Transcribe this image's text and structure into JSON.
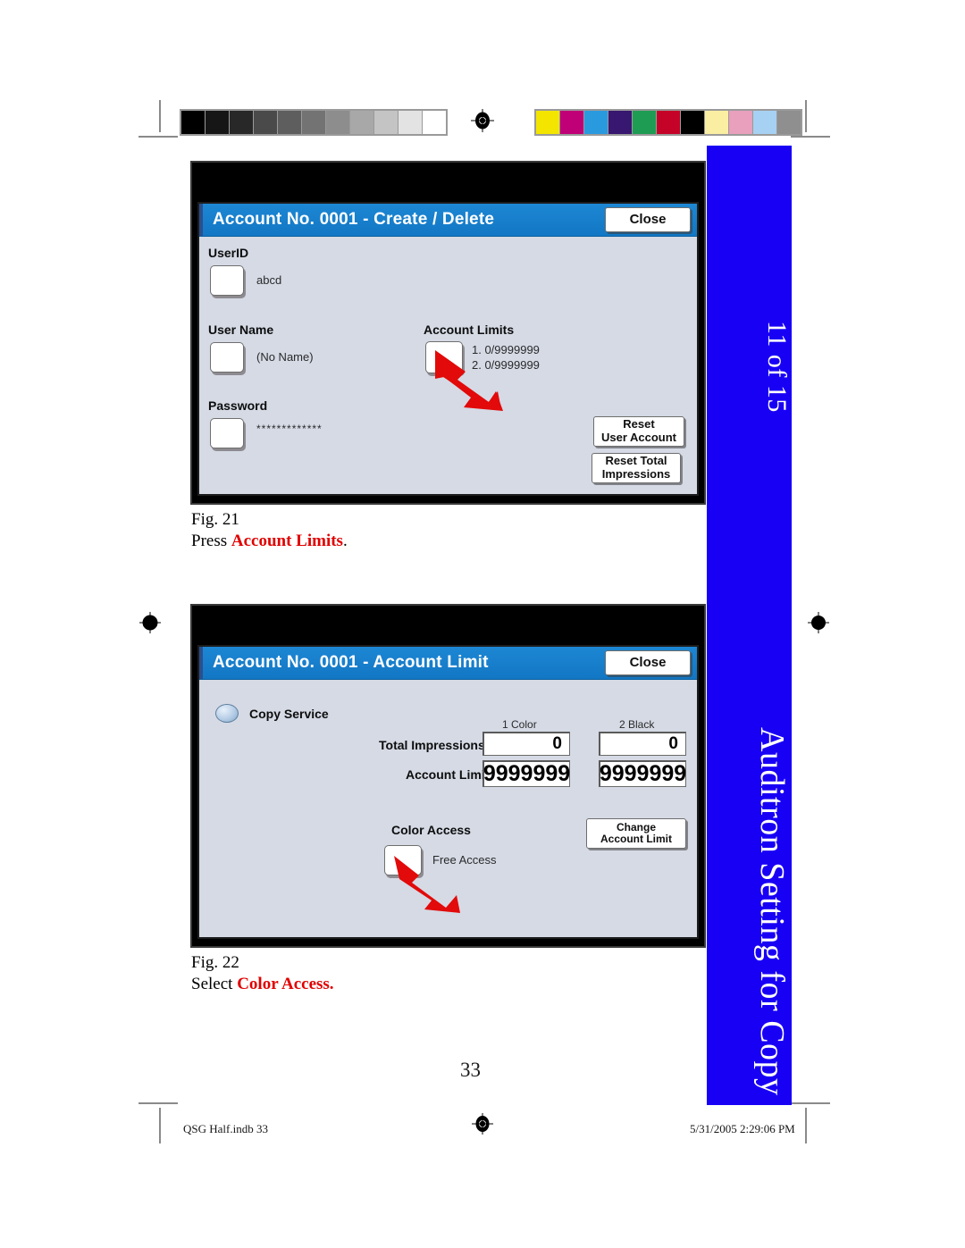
{
  "document": {
    "page_number": "33",
    "footer_left": "QSG Half.indb   33",
    "footer_right": "5/31/2005   2:29:06 PM"
  },
  "side_tab": {
    "top_label": "11 of 15",
    "bottom_label": "Auditron Setting for Copy",
    "color": "#1800f5"
  },
  "figures": [
    {
      "id": "fig21",
      "caption_line1": "Fig. 21",
      "caption_prefix": "Press ",
      "caption_emphasis": "Account Limits",
      "caption_suffix": "."
    },
    {
      "id": "fig22",
      "caption_line1": "Fig. 22",
      "caption_prefix": "Select ",
      "caption_emphasis": "Color Access.",
      "caption_suffix": ""
    }
  ],
  "screen1": {
    "title": "Account No. 0001 - Create / Delete",
    "close_label": "Close",
    "userid_label": "UserID",
    "userid_value": "abcd",
    "username_label": "User Name",
    "username_value": "(No Name)",
    "password_label": "Password",
    "password_value": "*************",
    "account_limits_label": "Account Limits",
    "account_limit_1": "1. 0/9999999",
    "account_limit_2": "2. 0/9999999",
    "reset_user_account_line1": "Reset",
    "reset_user_account_line2": "User Account",
    "reset_total_line1": "Reset Total",
    "reset_total_line2": "Impressions"
  },
  "screen2": {
    "title": "Account No. 0001 - Account Limit",
    "close_label": "Close",
    "service_label": "Copy Service",
    "col1_header": "1 Color",
    "col2_header": "2 Black",
    "row1_label": "Total Impressions",
    "row1_col1": "0",
    "row1_col2": "0",
    "row2_label": "Account Limit",
    "row2_col1": "9999999",
    "row2_col2": "9999999",
    "color_access_label": "Color Access",
    "free_access_label": "Free Access",
    "change_limit_line1": "Change",
    "change_limit_line2": "Account Limit"
  },
  "calibration": {
    "grayscale": [
      "#000000",
      "#161616",
      "#282828",
      "#4a4a4a",
      "#5e5e5e",
      "#737373",
      "#8d8d8d",
      "#a8a8a8",
      "#c4c4c4",
      "#e3e3e3",
      "#ffffff"
    ],
    "colors": [
      "#f3e500",
      "#bf0076",
      "#2a9adf",
      "#37176f",
      "#1f9c54",
      "#c50227",
      "#000000",
      "#faeea2",
      "#e8a0bd",
      "#a6d1f2",
      "#8f8f8f"
    ]
  }
}
